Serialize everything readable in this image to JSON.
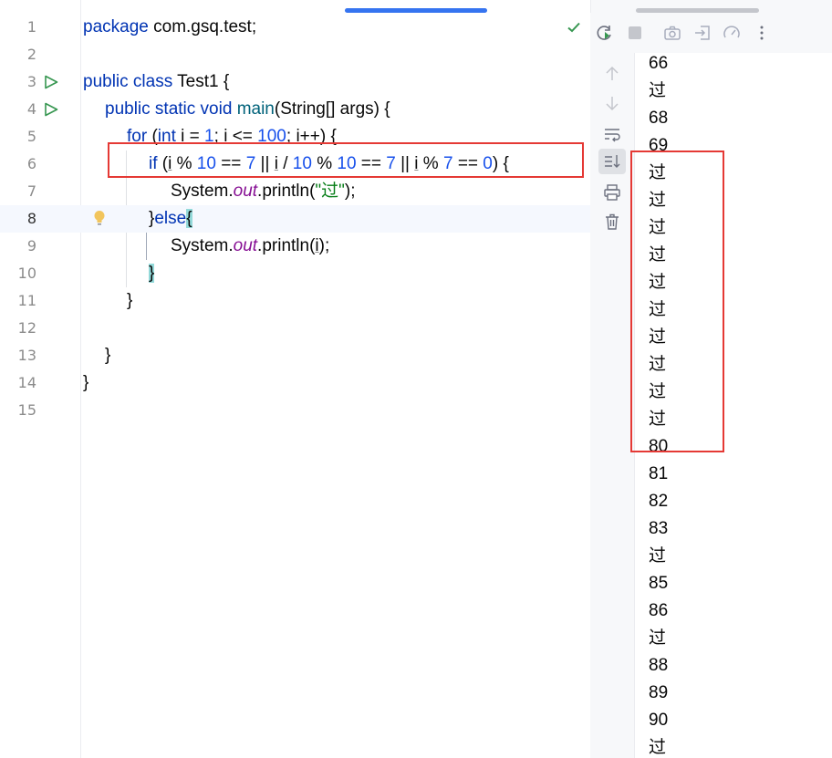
{
  "editor": {
    "line_numbers": [
      "1",
      "2",
      "3",
      "4",
      "5",
      "6",
      "7",
      "8",
      "9",
      "10",
      "11",
      "12",
      "13",
      "14",
      "15"
    ],
    "lines": {
      "l1": {
        "kw": "package",
        "rest": " com.gsq.test;"
      },
      "l3": {
        "kw": "public class",
        "rest": " Test1 {"
      },
      "l4": {
        "kw": "public static void",
        "method": "main",
        "rest": "(String[] args) {"
      },
      "l5": {
        "kw1": "for",
        "p1": " (",
        "kw2": "int",
        "sp": " ",
        "v1": "i",
        "p2": " = ",
        "n1": "1",
        "p3": "; ",
        "v2": "i",
        "p4": " <= ",
        "n2": "100",
        "p5": "; ",
        "v3": "i",
        "p6": "++) {"
      },
      "l6": {
        "kw": "if",
        "p1": " (",
        "v1": "i",
        "p2": " % ",
        "n1": "10",
        "p3": " == ",
        "n2": "7",
        "p4": " || ",
        "v2": "i",
        "p5": " / ",
        "n3": "10",
        "p6": " % ",
        "n4": "10",
        "p7": " == ",
        "n5": "7",
        "p8": " || ",
        "v3": "i",
        "p9": " % ",
        "n6": "7",
        "p10": " == ",
        "n7": "0",
        "p11": ") {"
      },
      "l7": {
        "a": "System.",
        "fld": "out",
        "b": ".println(",
        "str": "\"过\"",
        "c": ");"
      },
      "l8": {
        "brace": "}",
        "kw": "else",
        "match": "{"
      },
      "l9": {
        "a": "System.",
        "fld": "out",
        "b": ".println(",
        "v": "i",
        "c": ");"
      },
      "l10": {
        "match": "}"
      },
      "l11": {
        "t": "}"
      },
      "l13": {
        "t": "}"
      },
      "l14": {
        "t": "}"
      }
    }
  },
  "console": {
    "output": [
      "66",
      "过",
      "68",
      "69",
      "过",
      "过",
      "过",
      "过",
      "过",
      "过",
      "过",
      "过",
      "过",
      "过",
      "80",
      "81",
      "82",
      "83",
      "过",
      "85",
      "86",
      "过",
      "88",
      "89",
      "90",
      "过"
    ]
  },
  "colors": {
    "highlight": "#e53935",
    "run_green": "#369650",
    "keyword": "#0033b3",
    "number": "#1750eb",
    "string": "#067d17",
    "field": "#871094"
  }
}
